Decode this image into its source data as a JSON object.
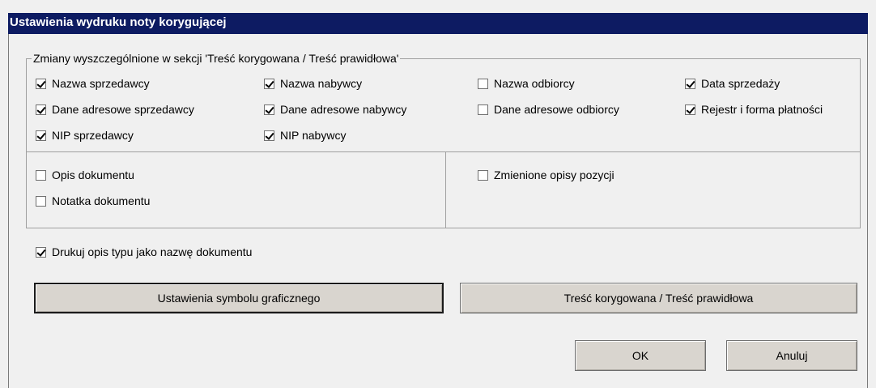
{
  "window": {
    "title": "Ustawienia wydruku noty korygującej"
  },
  "group": {
    "legend": "Zmiany wyszczególnione w sekcji 'Treść korygowana / Treść prawidłowa'",
    "top_checkboxes": [
      {
        "label": "Nazwa sprzedawcy",
        "checked": true
      },
      {
        "label": "Dane adresowe sprzedawcy",
        "checked": true
      },
      {
        "label": "NIP sprzedawcy",
        "checked": true
      },
      {
        "label": "Nazwa nabywcy",
        "checked": true
      },
      {
        "label": "Dane adresowe nabywcy",
        "checked": true
      },
      {
        "label": "NIP nabywcy",
        "checked": true
      },
      {
        "label": "Nazwa odbiorcy",
        "checked": false
      },
      {
        "label": "Dane adresowe odbiorcy",
        "checked": false
      },
      {
        "label": "Data sprzedaży",
        "checked": true
      },
      {
        "label": "Rejestr i forma płatności",
        "checked": true
      }
    ],
    "bottom_checkboxes": [
      {
        "label": "Opis dokumentu",
        "checked": false
      },
      {
        "label": "Notatka dokumentu",
        "checked": false
      },
      {
        "label": "Zmienione opisy pozycji",
        "checked": false
      }
    ]
  },
  "print_type_checkbox": {
    "label": "Drukuj opis typu jako nazwę dokumentu",
    "checked": true
  },
  "buttons": {
    "graphic_symbol": "Ustawienia symbolu graficznego",
    "corrected_content": "Treść korygowana / Treść prawidłowa",
    "ok": "OK",
    "cancel": "Anuluj"
  }
}
